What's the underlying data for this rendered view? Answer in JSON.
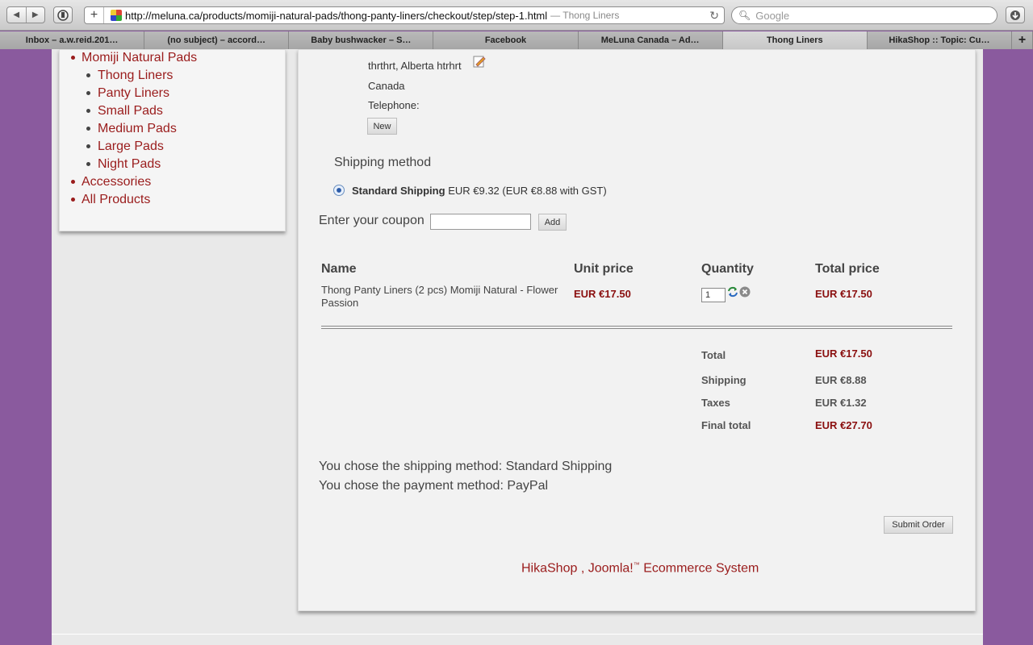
{
  "browser": {
    "url": "http://meluna.ca/products/momiji-natural-pads/thong-panty-liners/checkout/step/step-1.html",
    "page_title": "— Thong Liners",
    "search_placeholder": "Google",
    "tabs": [
      {
        "label": "Inbox – a.w.reid.201…"
      },
      {
        "label": "(no subject) – accord…"
      },
      {
        "label": "Baby bushwacker – S…"
      },
      {
        "label": "Facebook"
      },
      {
        "label": "MeLuna Canada – Ad…"
      },
      {
        "label": "Thong Liners"
      },
      {
        "label": "HikaShop :: Topic: Cu…"
      }
    ]
  },
  "sidebar": {
    "category": "Momiji Natural Pads",
    "subitems": [
      "Thong Liners",
      "Panty Liners",
      "Small Pads",
      "Medium Pads",
      "Large Pads",
      "Night Pads"
    ],
    "accessories": "Accessories",
    "all_products": "All Products"
  },
  "address": {
    "line": "thrthrt, Alberta htrhrt",
    "country": "Canada",
    "telephone_label": "Telephone:",
    "new_button": "New"
  },
  "shipping": {
    "heading": "Shipping method",
    "option_name": "Standard Shipping",
    "option_price": "EUR €9.32 (EUR €8.88 with GST)"
  },
  "coupon": {
    "label": "Enter your coupon",
    "value": "",
    "add_button": "Add"
  },
  "cart": {
    "headers": {
      "name": "Name",
      "unit_price": "Unit price",
      "quantity": "Quantity",
      "total_price": "Total price"
    },
    "items": [
      {
        "name": "Thong Panty Liners (2 pcs) Momiji Natural - Flower Passion",
        "unit_price": "EUR €17.50",
        "quantity": "1",
        "total_price": "EUR €17.50"
      }
    ]
  },
  "totals": {
    "total_label": "Total",
    "total_value": "EUR €17.50",
    "shipping_label": "Shipping",
    "shipping_value": "EUR €8.88",
    "taxes_label": "Taxes",
    "taxes_value": "EUR €1.32",
    "final_label": "Final total",
    "final_value": "EUR €27.70"
  },
  "messages": {
    "shipping_chosen": "You chose the shipping method: Standard Shipping",
    "payment_chosen": "You chose the payment method: PayPal"
  },
  "submit_button": "Submit Order",
  "footer": {
    "hikashop": "HikaShop",
    "sep": " , ",
    "joomla": "Joomla!",
    "tm": "™",
    "rest": " Ecommerce System"
  },
  "colors": {
    "accent": "#8a0f0f",
    "link": "#9a1c1c",
    "background": "#8a5a9e"
  }
}
